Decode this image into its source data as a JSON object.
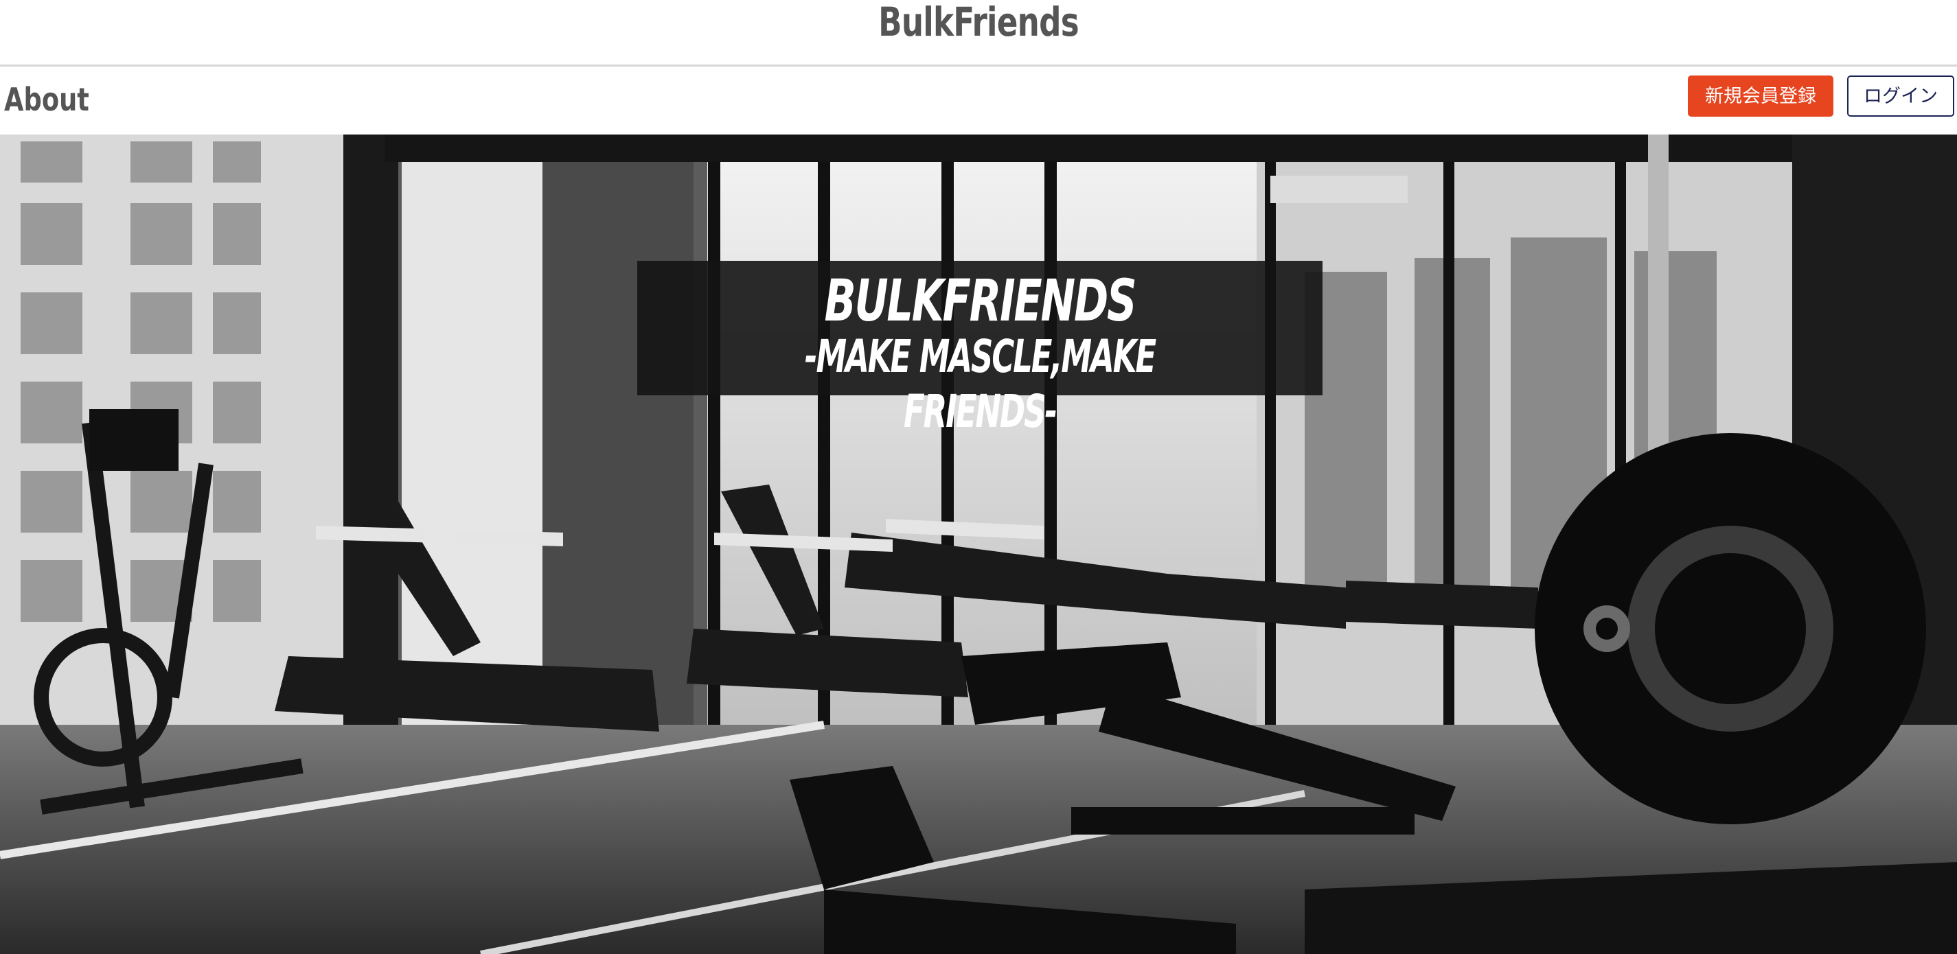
{
  "header": {
    "brand": "BulkFriends"
  },
  "nav": {
    "about": "About",
    "register_label": "新規会員登録",
    "login_label": "ログイン"
  },
  "hero": {
    "title": "BULKFRIENDS",
    "subtitle": "-MAKE MASCLE,MAKE FRIENDS-"
  },
  "colors": {
    "register_button": "#e6451f",
    "login_border": "#1c2254",
    "brand_text": "#555555"
  }
}
